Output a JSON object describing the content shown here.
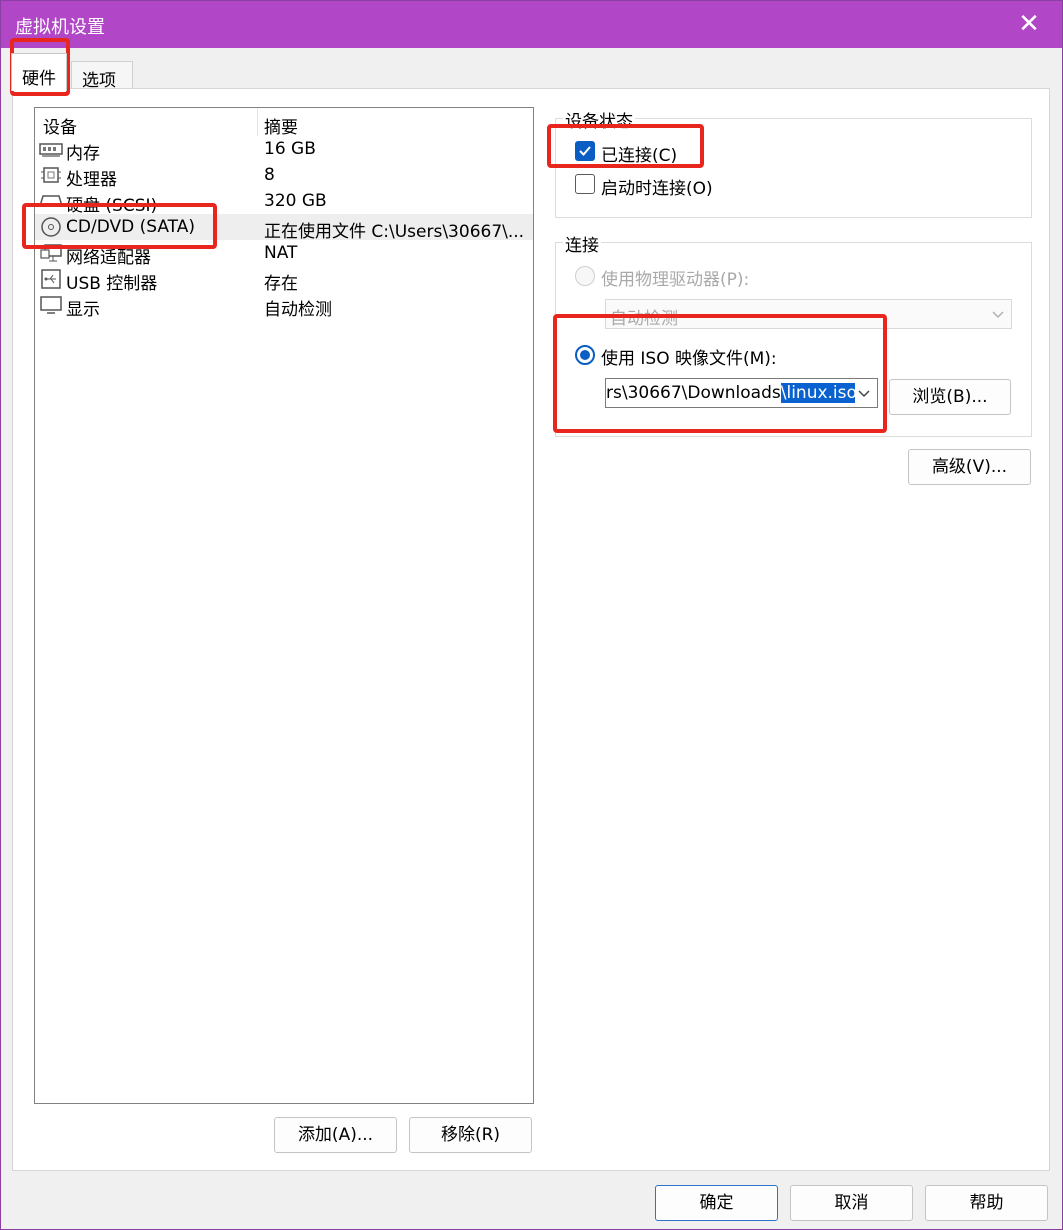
{
  "window": {
    "title": "虚拟机设置",
    "close_label": "✕"
  },
  "tabs": [
    {
      "label": "硬件"
    },
    {
      "label": "选项"
    }
  ],
  "device_list": {
    "headers": {
      "device": "设备",
      "summary": "摘要"
    },
    "rows": [
      {
        "name": "内存",
        "summary": "16 GB",
        "icon": "memory-icon"
      },
      {
        "name": "处理器",
        "summary": "8",
        "icon": "processor-icon"
      },
      {
        "name": "硬盘 (SCSI)",
        "summary": "320 GB",
        "icon": "harddisk-icon"
      },
      {
        "name": "CD/DVD (SATA)",
        "summary": "正在使用文件 C:\\Users\\30667\\...",
        "icon": "cd-dvd-icon",
        "selected": true
      },
      {
        "name": "网络适配器",
        "summary": "NAT",
        "icon": "network-adapter-icon"
      },
      {
        "name": "USB 控制器",
        "summary": "存在",
        "icon": "usb-icon"
      },
      {
        "name": "显示",
        "summary": "自动检测",
        "icon": "display-icon"
      }
    ]
  },
  "list_buttons": {
    "add": "添加(A)...",
    "remove": "移除(R)"
  },
  "device_status": {
    "group_label": "设备状态",
    "connected": {
      "label": "已连接(C)",
      "checked": true
    },
    "connect_at_power_on": {
      "label": "启动时连接(O)",
      "checked": false
    }
  },
  "connection": {
    "group_label": "连接",
    "physical_drive": {
      "label": "使用物理驱动器(P):",
      "selected": false,
      "dropdown_value": "自动检测"
    },
    "iso_image": {
      "label": "使用 ISO 映像文件(M):",
      "selected": true,
      "path_visible": "rs\\30667\\Downloads",
      "path_selected": "\\linux.iso"
    },
    "browse_button": "浏览(B)..."
  },
  "advanced_button": "高级(V)...",
  "dialog_buttons": {
    "ok": "确定",
    "cancel": "取消",
    "help": "帮助"
  },
  "colors": {
    "titlebar": "#b147c6",
    "accent": "#0a5dc2",
    "annotation": "#e8261d"
  }
}
